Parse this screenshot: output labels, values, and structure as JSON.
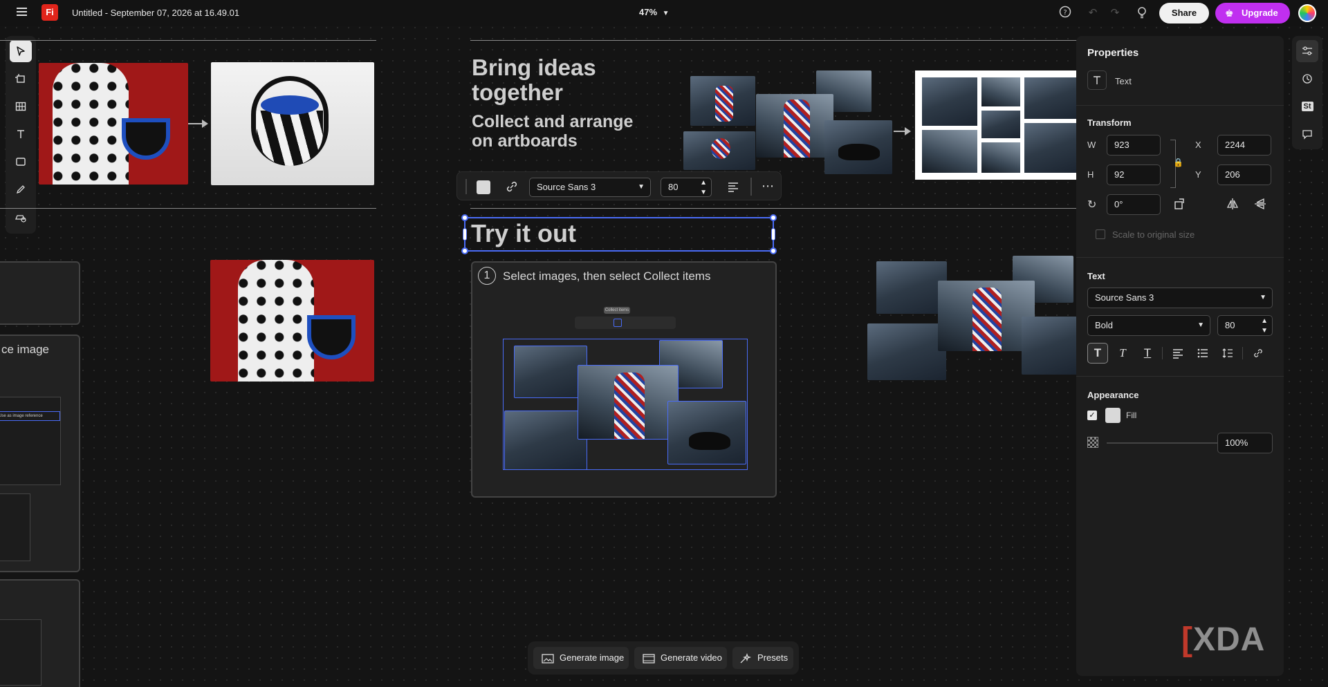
{
  "app": {
    "logo": "Fi",
    "doc_title": "Untitled - September 07, 2026 at 16.49.01",
    "zoom": "47%"
  },
  "topbar": {
    "share_label": "Share",
    "upgrade_label": "Upgrade"
  },
  "canvas": {
    "headline_1": "Bring ideas together",
    "headline_2": "Collect and arrange on artboards",
    "try_title": "Try it out",
    "step_number": "1",
    "step_text": "Select images, then select Collect items",
    "mini_tooltip": "Collect items",
    "left_card_text": "ce image",
    "left_card_button": "Use as image reference"
  },
  "text_toolbar": {
    "font": "Source Sans 3",
    "size": "80"
  },
  "properties": {
    "title": "Properties",
    "type_label": "Text",
    "transform_title": "Transform",
    "w_label": "W",
    "w_value": "923",
    "h_label": "H",
    "h_value": "92",
    "x_label": "X",
    "x_value": "2244",
    "y_label": "Y",
    "y_value": "206",
    "rotation_value": "0°",
    "scale_label": "Scale to original size",
    "text_title": "Text",
    "font_family": "Source Sans 3",
    "font_weight": "Bold",
    "font_size": "80",
    "appearance_title": "Appearance",
    "fill_label": "Fill",
    "fill_checked": true,
    "opacity_value": "100%",
    "opacity_fraction": 1.0
  },
  "bottom": {
    "generate_image": "Generate image",
    "generate_video": "Generate video",
    "presets": "Presets"
  },
  "watermark": "XDA",
  "colors": {
    "accent": "#4a6cf7",
    "upgrade": "#c02ff0",
    "logo": "#e1251b"
  }
}
